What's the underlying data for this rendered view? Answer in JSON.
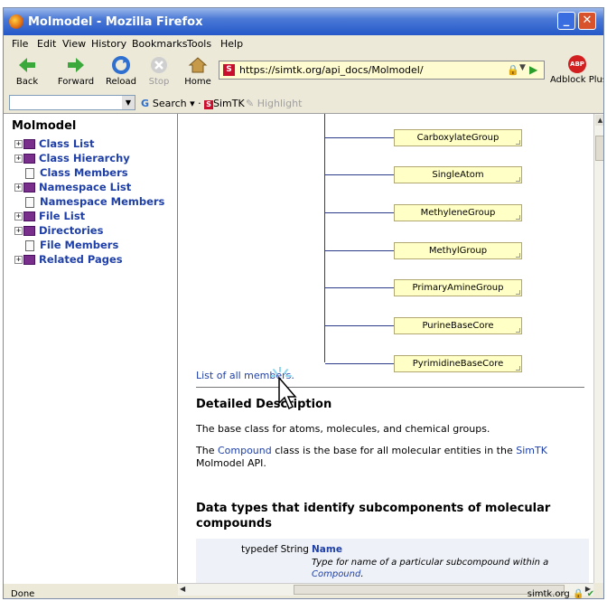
{
  "window": {
    "title": "Molmodel - Mozilla Firefox"
  },
  "menu": [
    "File",
    "Edit",
    "View",
    "History",
    "Bookmarks",
    "Tools",
    "Help"
  ],
  "nav": {
    "back": "Back",
    "forward": "Forward",
    "reload": "Reload",
    "stop": "Stop",
    "home": "Home"
  },
  "address": {
    "url": "https://simtk.org/api_docs/Molmodel/",
    "favicon": "S"
  },
  "adblock": {
    "label": "Adblock Plus",
    "badge": "ABP"
  },
  "toolbar2": {
    "search": "Search",
    "simtk": "SimTK",
    "highlight": "Highlight"
  },
  "sidebar": {
    "title": "Molmodel",
    "items": [
      {
        "label": "Class List",
        "kind": "book"
      },
      {
        "label": "Class Hierarchy",
        "kind": "book"
      },
      {
        "label": "Class Members",
        "kind": "doc"
      },
      {
        "label": "Namespace List",
        "kind": "book"
      },
      {
        "label": "Namespace Members",
        "kind": "doc"
      },
      {
        "label": "File List",
        "kind": "book"
      },
      {
        "label": "Directories",
        "kind": "book"
      },
      {
        "label": "File Members",
        "kind": "doc"
      },
      {
        "label": "Related Pages",
        "kind": "book"
      }
    ]
  },
  "diagram": {
    "boxes": [
      "CarboxylateGroup",
      "SingleAtom",
      "MethyleneGroup",
      "MethylGroup",
      "PrimaryAmineGroup",
      "PurineBaseCore",
      "PyrimidineBaseCore"
    ]
  },
  "content": {
    "list_link": "List of all members.",
    "detail_heading": "Detailed Description",
    "desc1": "The base class for atoms, molecules, and chemical groups.",
    "desc2_pre": "The ",
    "desc2_link1": "Compound",
    "desc2_mid": " class is the base for all molecular entities in the ",
    "desc2_link2": "SimTK",
    "desc2_post": " Molmodel API.",
    "datatypes_heading_line1": "Data types that identify subcomponents of molecular",
    "datatypes_heading_line2": "compounds",
    "member": {
      "type": "typedef String",
      "name": "Name",
      "desc_pre": "Type for name of a particular subcompound within a ",
      "desc_link": "Compound",
      "desc_post": "."
    }
  },
  "status": {
    "left": "Done",
    "right": "simtk.org"
  }
}
